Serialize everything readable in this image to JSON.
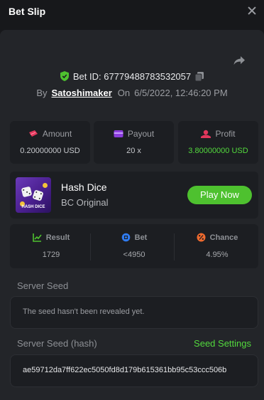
{
  "header": {
    "title": "Bet Slip"
  },
  "bet": {
    "id_text": "Bet ID: 67779488783532057",
    "by_label": "By",
    "username": "Satoshimaker",
    "on_label": "On",
    "date": "6/5/2022, 12:46:20 PM"
  },
  "stats": {
    "amount": {
      "label": "Amount",
      "value": "0.20000000 USD"
    },
    "payout": {
      "label": "Payout",
      "value": "20 x"
    },
    "profit": {
      "label": "Profit",
      "value": "3.80000000 USD"
    }
  },
  "game": {
    "thumb_text": "HASH DICE",
    "name": "Hash Dice",
    "subtitle": "BC Original",
    "play_label": "Play Now"
  },
  "result": {
    "result": {
      "label": "Result",
      "value": "1729"
    },
    "bet": {
      "label": "Bet",
      "value": "<4950"
    },
    "chance": {
      "label": "Chance",
      "value": "4.95%"
    }
  },
  "seeds": {
    "server_seed_label": "Server Seed",
    "server_seed_value": "The seed hasn't been revealed yet.",
    "server_hash_label": "Server Seed (hash)",
    "seed_settings_label": "Seed Settings",
    "server_hash_value": "ae59712da7ff622ec5050fd8d179b615361bb95c53ccc506b"
  },
  "colors": {
    "accent_green": "#4ec12f",
    "profit_green": "#53d93d",
    "background": "#17181b",
    "panel": "#232529"
  },
  "icons": [
    "close-icon",
    "share-icon",
    "shield-check-icon",
    "copy-icon",
    "amount-icon",
    "payout-icon",
    "profit-icon",
    "result-icon",
    "bet-icon",
    "chance-icon"
  ]
}
